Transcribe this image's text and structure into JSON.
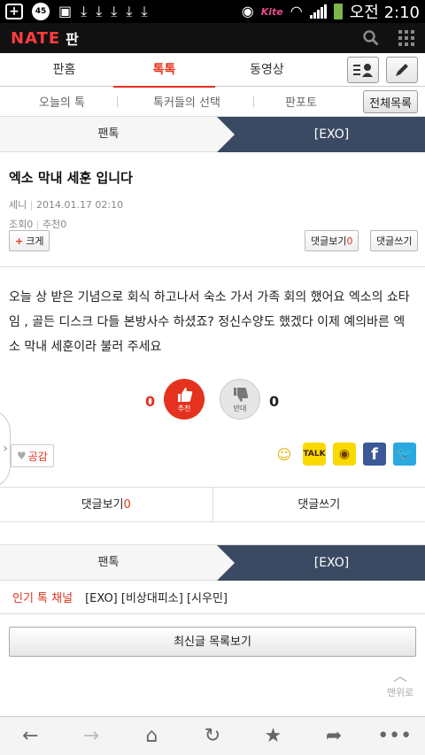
{
  "status": {
    "notification_count": "45",
    "carrier": "Kite",
    "time": "오전 2:10"
  },
  "app": {
    "logo": "NATE",
    "section": "판"
  },
  "tabs": [
    "판홈",
    "톡톡",
    "동영상"
  ],
  "subtabs": [
    "오늘의 톡",
    "톡커들의 선택",
    "판포토"
  ],
  "subtab_all": "전체목록",
  "crumb": {
    "left": "팬톡",
    "right": "[EXO]"
  },
  "article": {
    "title": "엑소 막내 세훈 입니다",
    "author": "세니",
    "date": "2014.01.17 02:10",
    "views_label": "조회",
    "views": "0",
    "recommend_label": "추천",
    "recommend": "0",
    "enlarge_label": "크게",
    "comments_view_label": "댓글보기",
    "comments_count": "0",
    "comment_write_label": "댓글쓰기",
    "body": "오늘 상 받은 기념으로 회식 하고나서 숙소 가서 가족 회의 했어요 엑소의 쇼타임 , 골든 디스크 다들 본방사수 하셨죠? 정신수양도 했겠다 이제 예의바른 엑소 막내 세훈이라 불러 주세요"
  },
  "votes": {
    "up_count": "0",
    "up_label": "추천",
    "down_count": "0",
    "down_label": "반대"
  },
  "empathy_label": "공감",
  "share": [
    "me2day",
    "kakaotalk",
    "kakaostory",
    "facebook",
    "twitter"
  ],
  "comment_bar": {
    "view_label": "댓글보기",
    "count": "0",
    "write_label": "댓글쓰기"
  },
  "popular": {
    "label": "인기 톡 채널",
    "items": "[EXO] [비상대피소] [시우민]"
  },
  "latest_button": "최신글 목록보기",
  "top_button": "맨위로",
  "colors": {
    "accent": "#e4321e",
    "crumb_dark": "#3b4a63"
  }
}
